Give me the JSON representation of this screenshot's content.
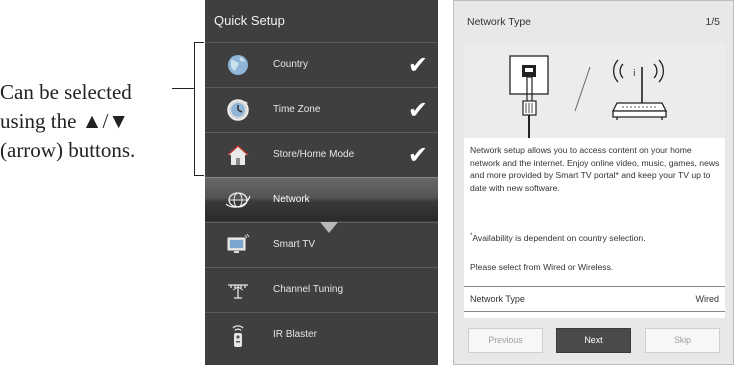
{
  "annotation": {
    "line1": "Can be selected",
    "line2": "using the ▲/▼",
    "line3": "(arrow) buttons."
  },
  "quick_setup": {
    "title": "Quick Setup",
    "items": [
      {
        "label": "Country",
        "icon": "globe-icon",
        "checked": true
      },
      {
        "label": "Time Zone",
        "icon": "clock-icon",
        "checked": true
      },
      {
        "label": "Store/Home Mode",
        "icon": "house-icon",
        "checked": true
      },
      {
        "label": "Network",
        "icon": "network-globe-icon",
        "selected": true
      },
      {
        "label": "Smart TV",
        "icon": "tv-icon"
      },
      {
        "label": "Channel Tuning",
        "icon": "antenna-icon"
      },
      {
        "label": "IR Blaster",
        "icon": "remote-icon"
      }
    ],
    "check_glyph": "✔"
  },
  "network_type": {
    "title": "Network Type",
    "page": "1/5",
    "description": "Network setup allows you to access content on your home network and the internet. Enjoy online video, music, games, news and more provided by Smart TV portal* and keep your TV up to date with new software.",
    "note_mark": "*",
    "note": "Availability is dependent on country selection.",
    "select_text": "Please select from Wired or Wireless.",
    "setting_label": "Network Type",
    "setting_value": "Wired",
    "buttons": {
      "previous": "Previous",
      "next": "Next",
      "skip": "Skip"
    }
  }
}
